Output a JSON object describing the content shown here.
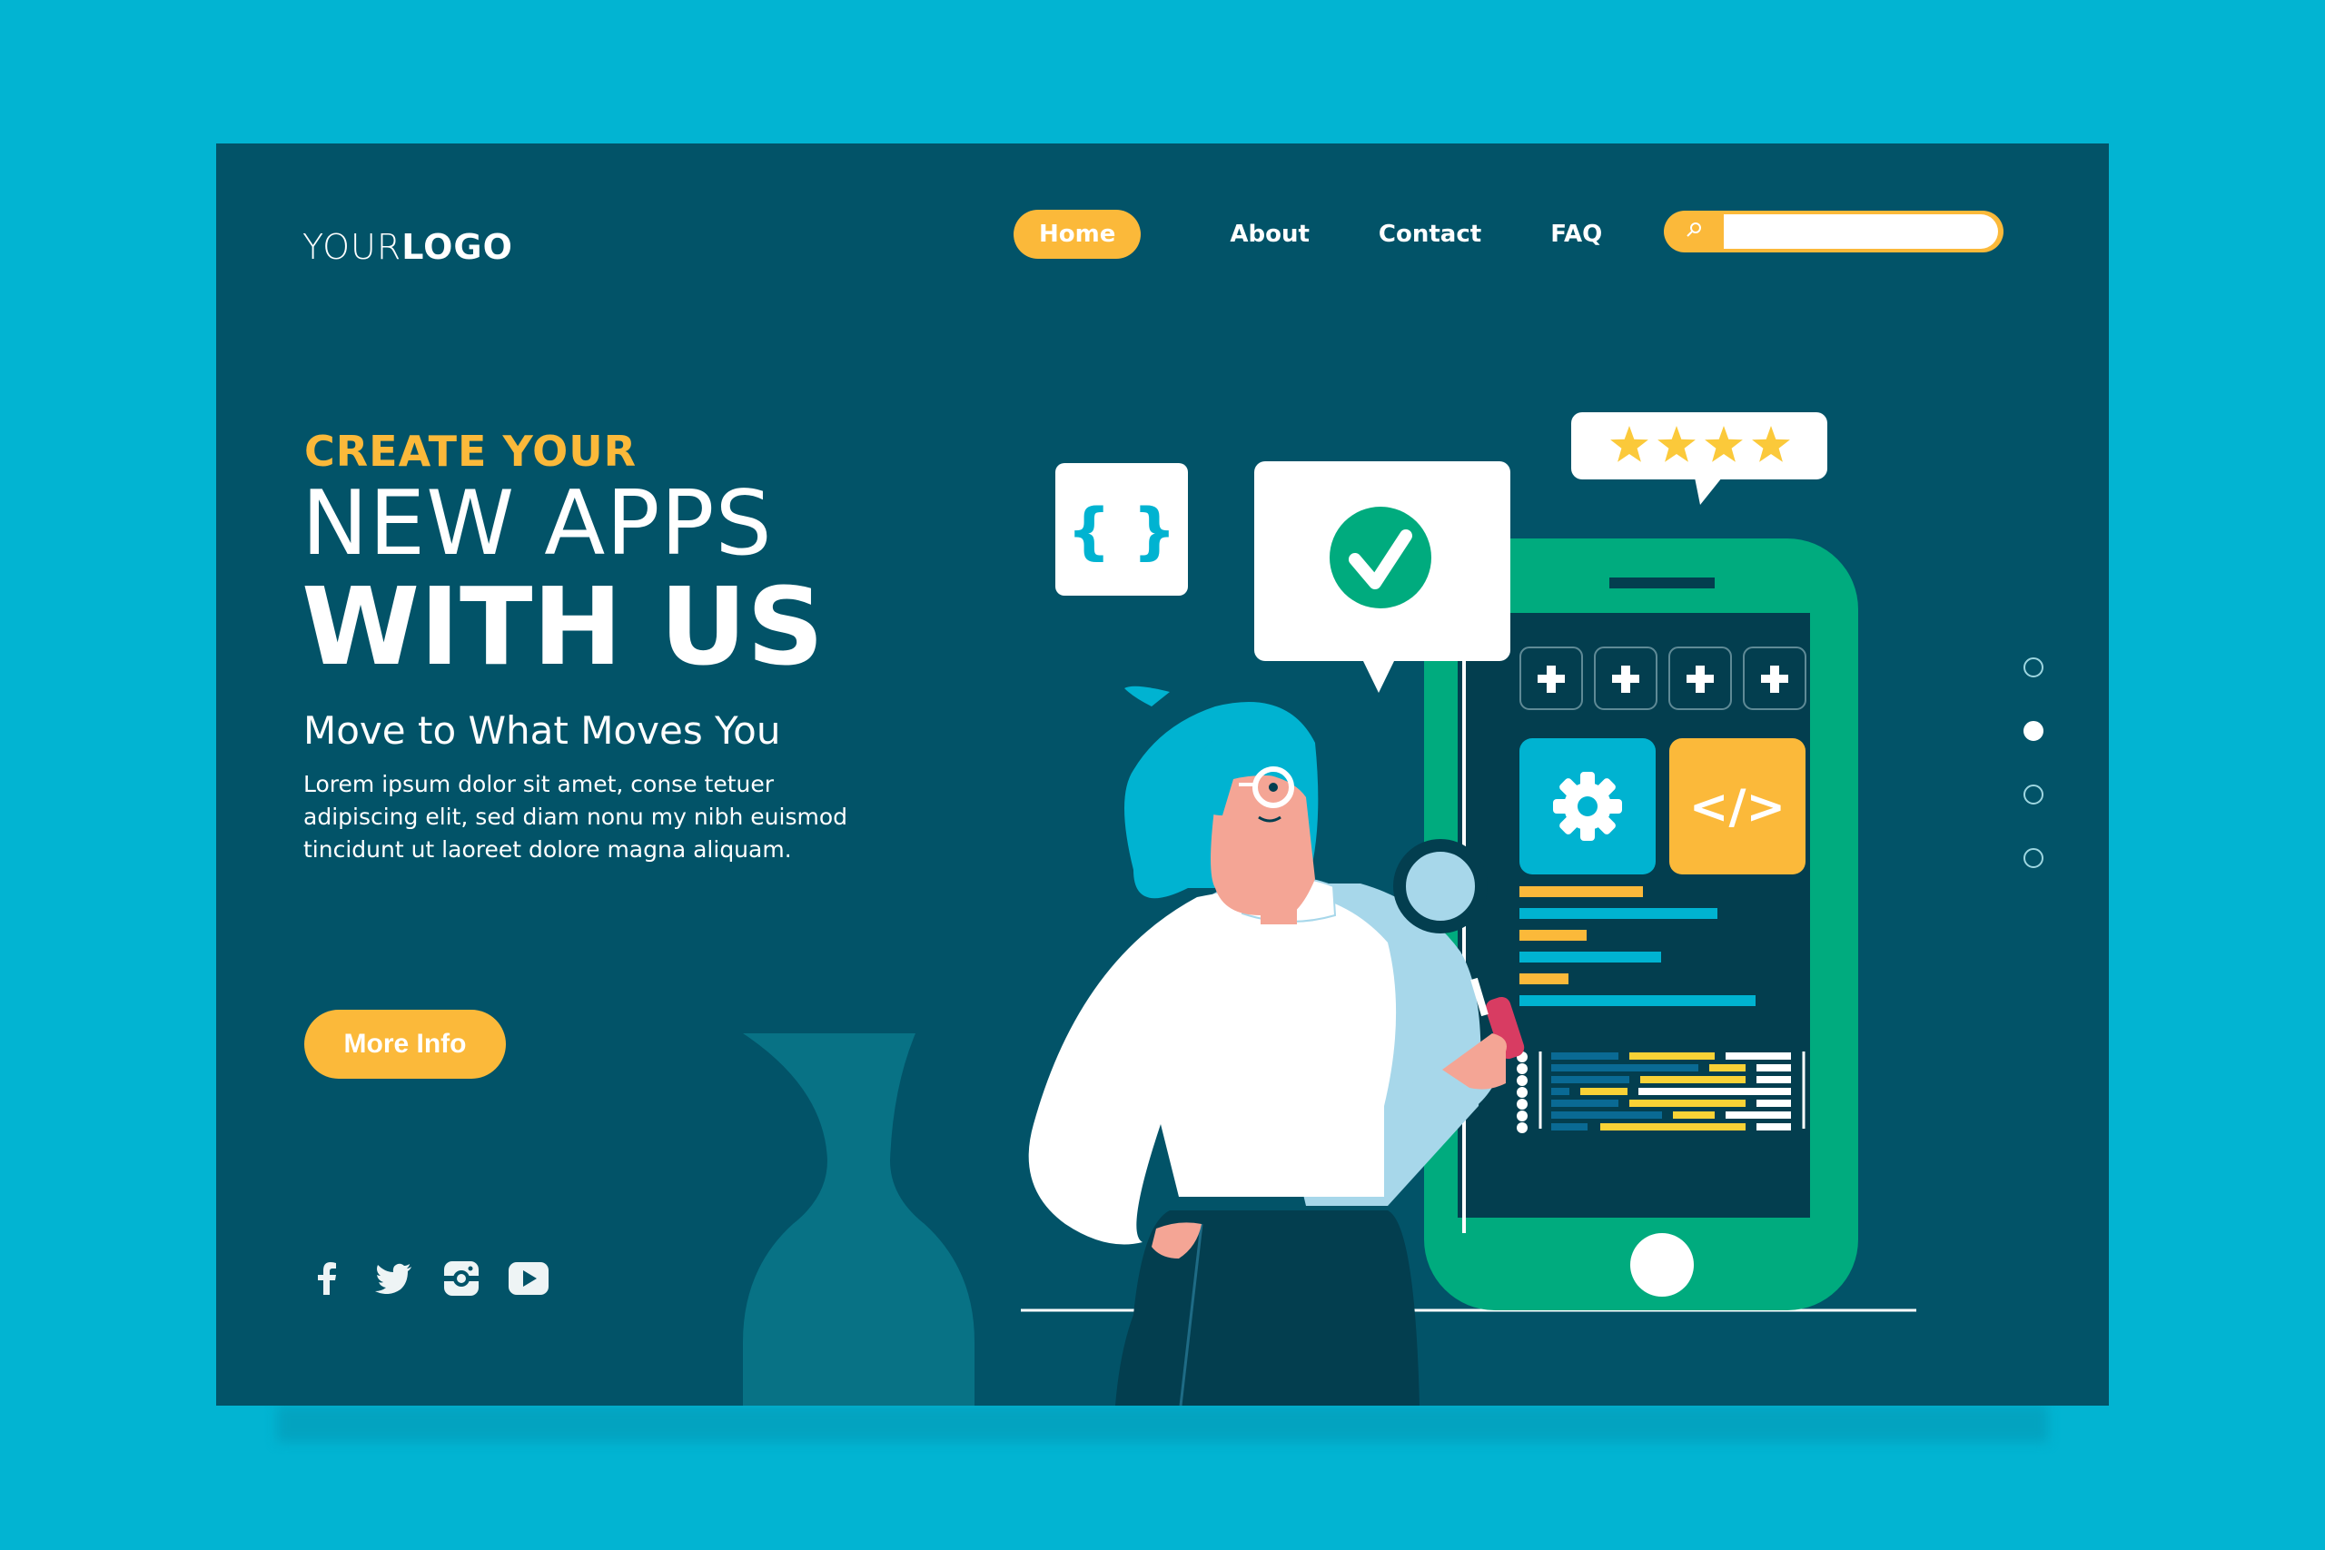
{
  "logo": {
    "light": "YOUR",
    "bold": "LOGO"
  },
  "nav": {
    "items": [
      {
        "label": "Home",
        "active": true
      },
      {
        "label": "About",
        "active": false
      },
      {
        "label": "Contact",
        "active": false
      },
      {
        "label": "FAQ",
        "active": false
      }
    ]
  },
  "search": {
    "icon": "search-icon",
    "value": "",
    "placeholder": ""
  },
  "hero": {
    "eyebrow": "CREATE YOUR",
    "title_line1": "NEW APPS",
    "title_line2": "WITH US",
    "subtitle": "Move to What Moves You",
    "body": "Lorem ipsum dolor sit amet, conse tetuer adipiscing elit, sed diam nonu my nibh euismod tincidunt ut laoreet dolore magna aliquam.",
    "cta_label": "More Info"
  },
  "socials": [
    "facebook-icon",
    "twitter-icon",
    "instagram-icon",
    "youtube-icon"
  ],
  "slider": {
    "count": 4,
    "active_index": 1
  },
  "illustration": {
    "rating_stars": 4,
    "code_braces": "{ }",
    "code_tag": "</>",
    "plus_buttons": 4
  },
  "colors": {
    "background": "#02b4d2",
    "page": "#025368",
    "accent": "#fbb93a",
    "green": "#00ab7e",
    "cyan": "#00b3d1"
  }
}
